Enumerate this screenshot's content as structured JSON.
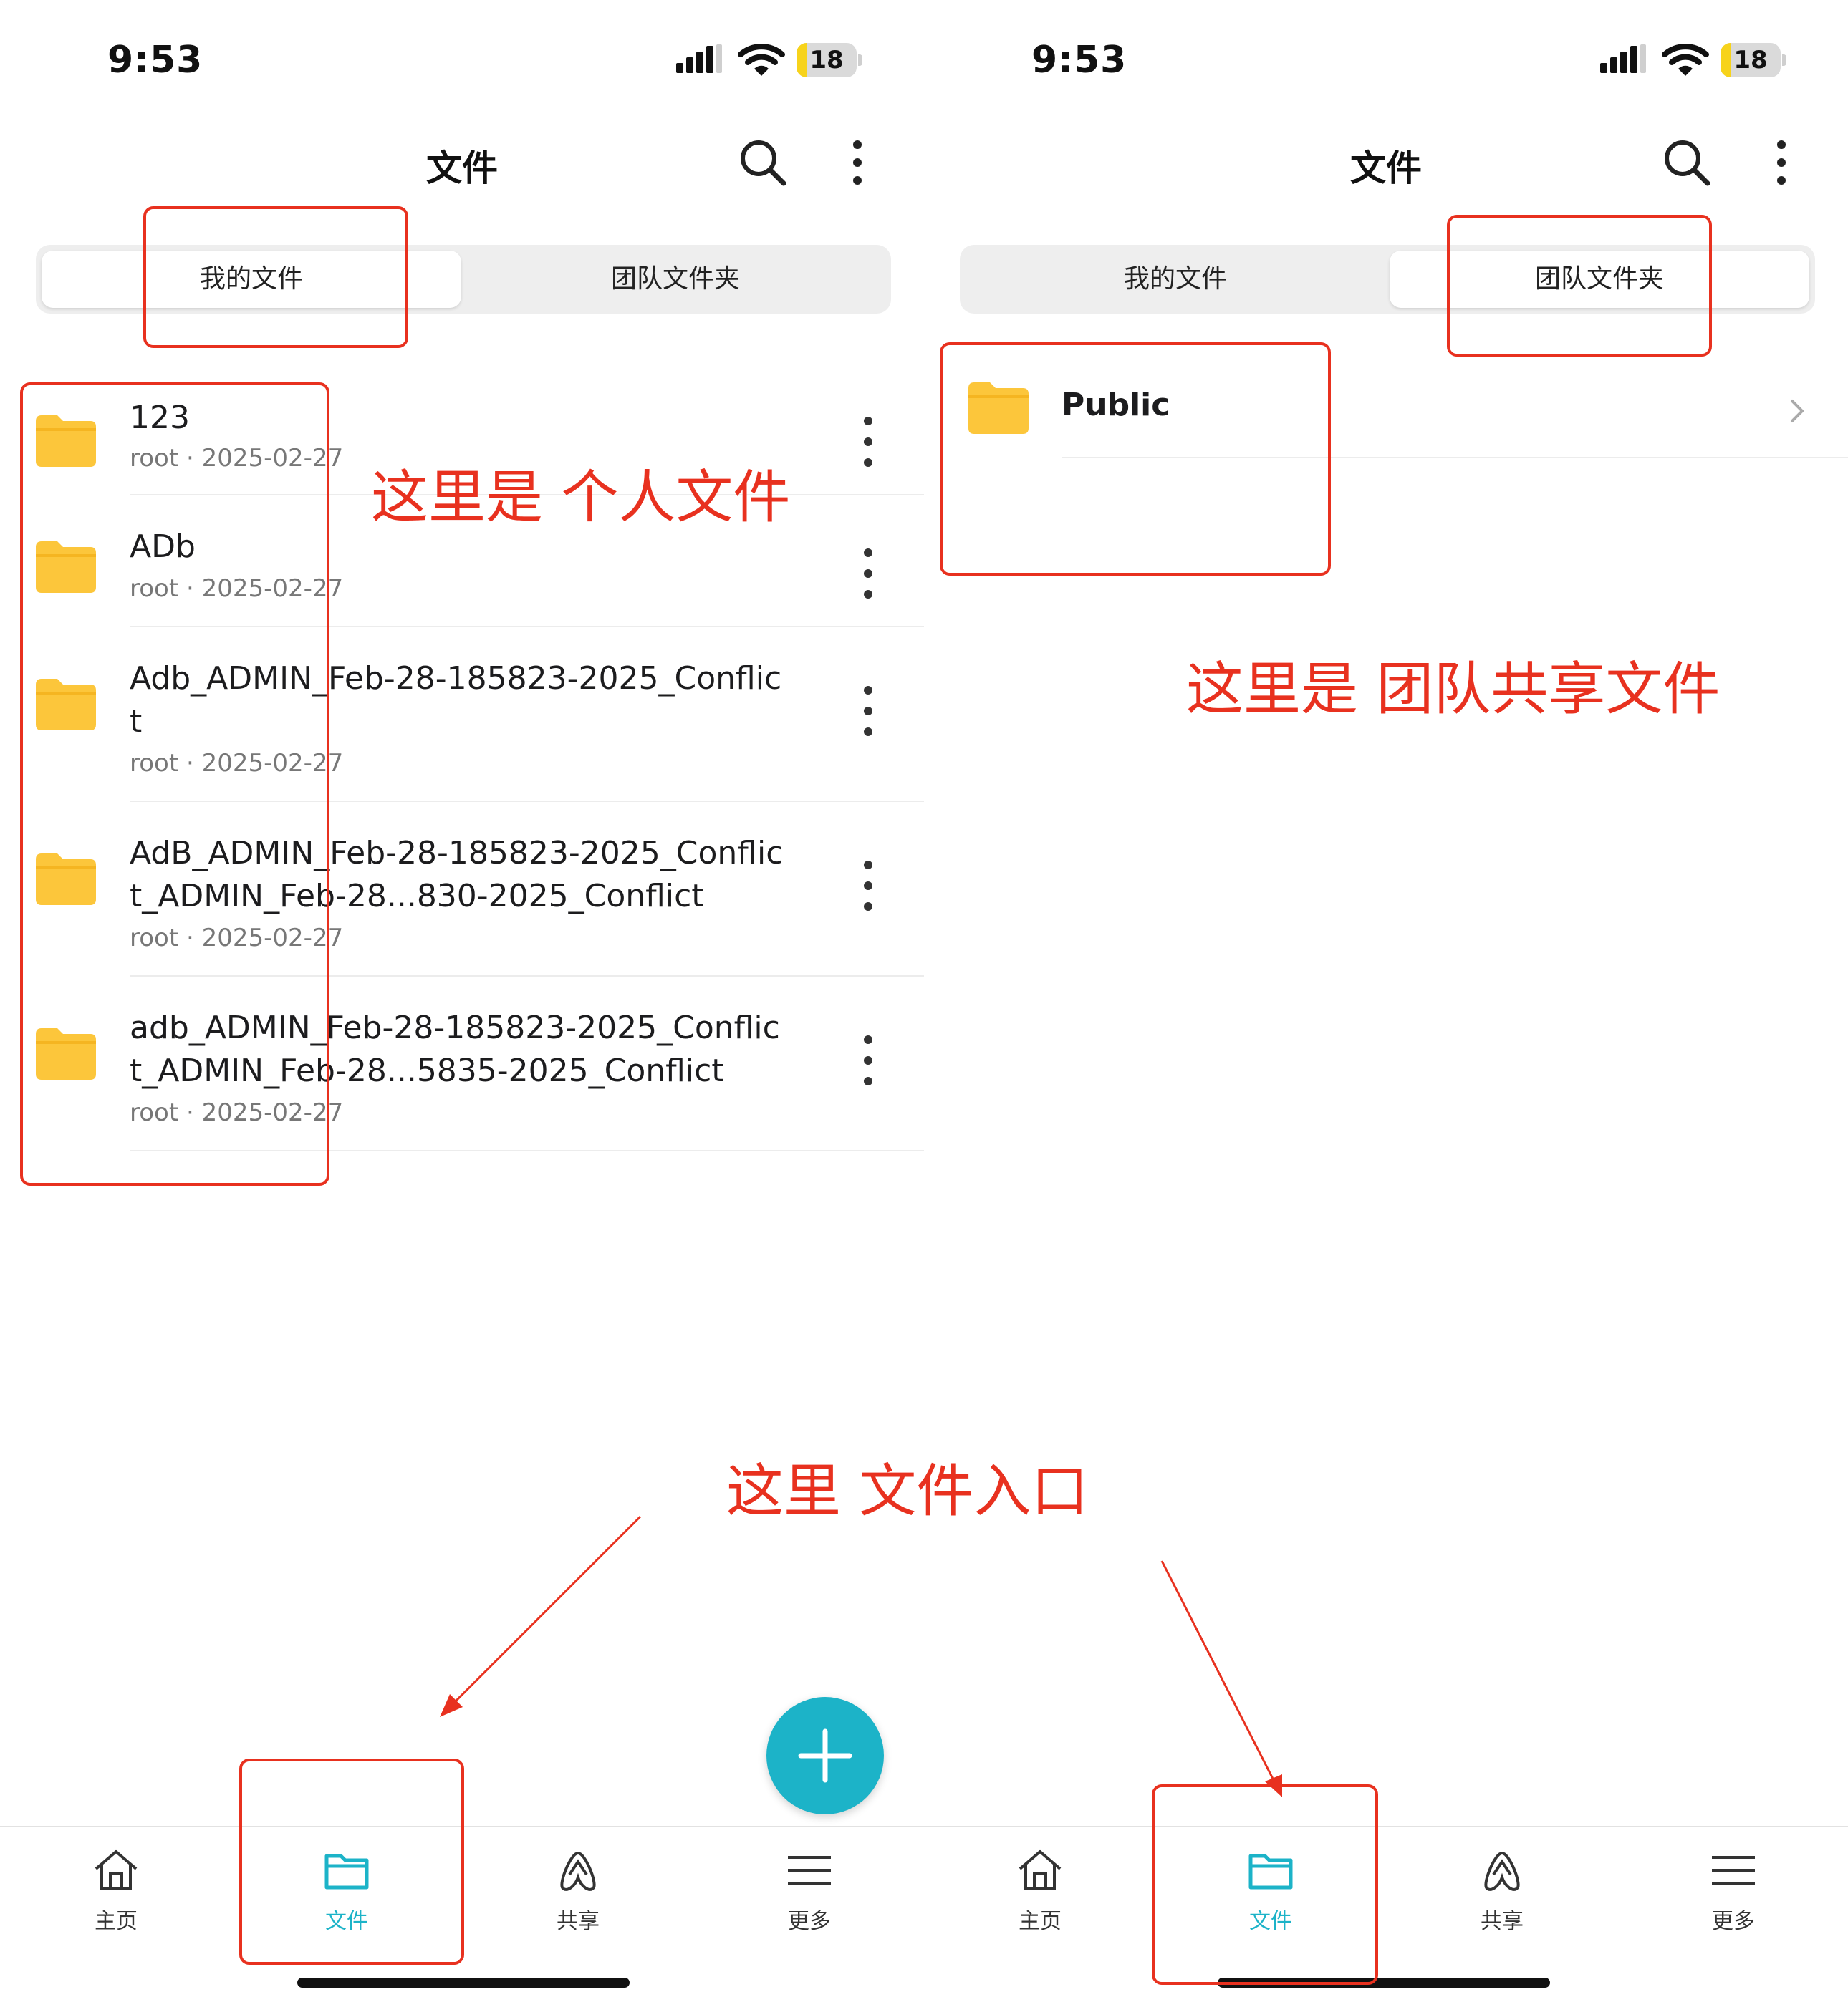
{
  "status": {
    "time": "9:53",
    "battery": "18",
    "battery_fraction": 0.18
  },
  "header": {
    "title": "文件"
  },
  "segments": {
    "my_files": "我的文件",
    "team_folders": "团队文件夹"
  },
  "my_files": [
    {
      "name": "123",
      "owner": "root",
      "date": "2025-02-27"
    },
    {
      "name": "ADb",
      "owner": "root",
      "date": "2025-02-27"
    },
    {
      "name": "Adb_ADMIN_Feb-28-185823-2025_Conflict",
      "owner": "root",
      "date": "2025-02-27"
    },
    {
      "name": "AdB_ADMIN_Feb-28-185823-2025_Conflict_ADMIN_Feb-28...830-2025_Conflict",
      "owner": "root",
      "date": "2025-02-27"
    },
    {
      "name": "adb_ADMIN_Feb-28-185823-2025_Conflict_ADMIN_Feb-28...5835-2025_Conflict",
      "owner": "root",
      "date": "2025-02-27"
    }
  ],
  "meta_separator": " · ",
  "team_folders": [
    {
      "name": "Public"
    }
  ],
  "nav": [
    {
      "label": "主页",
      "icon": "home-icon"
    },
    {
      "label": "文件",
      "icon": "folder-icon"
    },
    {
      "label": "共享",
      "icon": "share-icon"
    },
    {
      "label": "更多",
      "icon": "menu-icon"
    }
  ],
  "colors": {
    "accent": "#1cb3c8",
    "folder": "#fcc63b",
    "annotation": "#e8311f"
  },
  "annotations": {
    "personal_files": "这里是 个人文件",
    "team_files": "这里是 团队共享文件",
    "files_entry": "这里 文件入口"
  }
}
